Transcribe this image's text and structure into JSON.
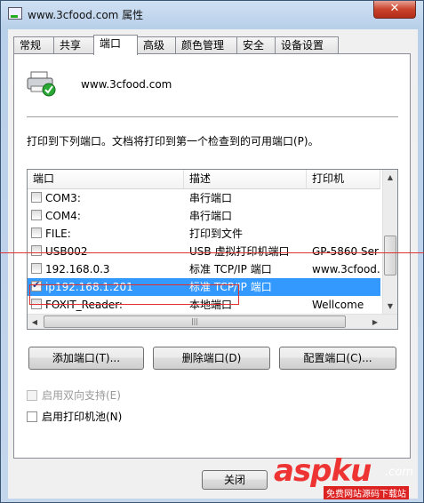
{
  "window": {
    "title": "www.3cfood.com 属性",
    "close_label": "✕"
  },
  "tabs": [
    "常规",
    "共享",
    "端口",
    "高级",
    "颜色管理",
    "安全",
    "设备设置"
  ],
  "printer": {
    "name": "www.3cfood.com"
  },
  "instruction": "打印到下列端口。文档将打印到第一个检查到的可用端口(P)。",
  "ports": {
    "columns": [
      "端口",
      "描述",
      "打印机"
    ],
    "rows": [
      {
        "port": "COM3:",
        "desc": "串行端口",
        "printer": "",
        "checked": false
      },
      {
        "port": "COM4:",
        "desc": "串行端口",
        "printer": "",
        "checked": false
      },
      {
        "port": "FILE:",
        "desc": "打印到文件",
        "printer": "",
        "checked": false
      },
      {
        "port": "USB002",
        "desc": "USB 虚拟打印机端口",
        "printer": "GP-5860 Ser",
        "checked": false
      },
      {
        "port": "192.168.0.3",
        "desc": "标准 TCP/IP 端口",
        "printer": "www.3cfood.",
        "checked": false
      },
      {
        "port": "ip192.168.1.201",
        "desc": "标准 TCP/IP 端口",
        "printer": "",
        "checked": true
      },
      {
        "port": "FOXIT_Reader:",
        "desc": "本地端口",
        "printer": "Wellcome",
        "checked": false
      }
    ]
  },
  "buttons": {
    "add_port": "添加端口(T)...",
    "delete_port": "删除端口(D)",
    "configure_port": "配置端口(C)...",
    "close": "关闭"
  },
  "options": {
    "bidirectional": "启用双向支持(E)",
    "pooling": "启用打印机池(N)"
  },
  "watermark": {
    "text": "aspku",
    "sub": "免费网站源码下载站",
    "suffix": ".com"
  }
}
